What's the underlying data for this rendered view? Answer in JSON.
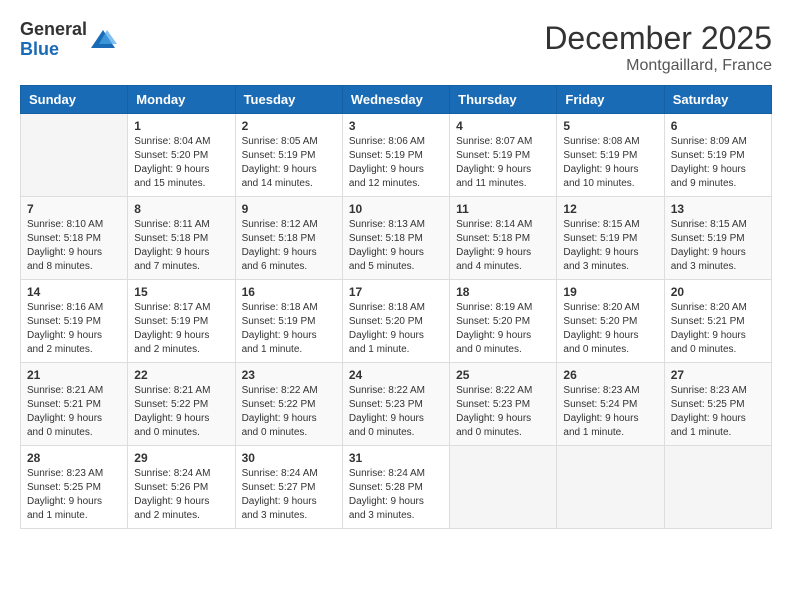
{
  "logo": {
    "general": "General",
    "blue": "Blue"
  },
  "title": {
    "month": "December 2025",
    "location": "Montgaillard, France"
  },
  "weekdays": [
    "Sunday",
    "Monday",
    "Tuesday",
    "Wednesday",
    "Thursday",
    "Friday",
    "Saturday"
  ],
  "weeks": [
    [
      {
        "day": "",
        "sunrise": "",
        "sunset": "",
        "daylight": ""
      },
      {
        "day": "1",
        "sunrise": "Sunrise: 8:04 AM",
        "sunset": "Sunset: 5:20 PM",
        "daylight": "Daylight: 9 hours and 15 minutes."
      },
      {
        "day": "2",
        "sunrise": "Sunrise: 8:05 AM",
        "sunset": "Sunset: 5:19 PM",
        "daylight": "Daylight: 9 hours and 14 minutes."
      },
      {
        "day": "3",
        "sunrise": "Sunrise: 8:06 AM",
        "sunset": "Sunset: 5:19 PM",
        "daylight": "Daylight: 9 hours and 12 minutes."
      },
      {
        "day": "4",
        "sunrise": "Sunrise: 8:07 AM",
        "sunset": "Sunset: 5:19 PM",
        "daylight": "Daylight: 9 hours and 11 minutes."
      },
      {
        "day": "5",
        "sunrise": "Sunrise: 8:08 AM",
        "sunset": "Sunset: 5:19 PM",
        "daylight": "Daylight: 9 hours and 10 minutes."
      },
      {
        "day": "6",
        "sunrise": "Sunrise: 8:09 AM",
        "sunset": "Sunset: 5:19 PM",
        "daylight": "Daylight: 9 hours and 9 minutes."
      }
    ],
    [
      {
        "day": "7",
        "sunrise": "Sunrise: 8:10 AM",
        "sunset": "Sunset: 5:18 PM",
        "daylight": "Daylight: 9 hours and 8 minutes."
      },
      {
        "day": "8",
        "sunrise": "Sunrise: 8:11 AM",
        "sunset": "Sunset: 5:18 PM",
        "daylight": "Daylight: 9 hours and 7 minutes."
      },
      {
        "day": "9",
        "sunrise": "Sunrise: 8:12 AM",
        "sunset": "Sunset: 5:18 PM",
        "daylight": "Daylight: 9 hours and 6 minutes."
      },
      {
        "day": "10",
        "sunrise": "Sunrise: 8:13 AM",
        "sunset": "Sunset: 5:18 PM",
        "daylight": "Daylight: 9 hours and 5 minutes."
      },
      {
        "day": "11",
        "sunrise": "Sunrise: 8:14 AM",
        "sunset": "Sunset: 5:18 PM",
        "daylight": "Daylight: 9 hours and 4 minutes."
      },
      {
        "day": "12",
        "sunrise": "Sunrise: 8:15 AM",
        "sunset": "Sunset: 5:19 PM",
        "daylight": "Daylight: 9 hours and 3 minutes."
      },
      {
        "day": "13",
        "sunrise": "Sunrise: 8:15 AM",
        "sunset": "Sunset: 5:19 PM",
        "daylight": "Daylight: 9 hours and 3 minutes."
      }
    ],
    [
      {
        "day": "14",
        "sunrise": "Sunrise: 8:16 AM",
        "sunset": "Sunset: 5:19 PM",
        "daylight": "Daylight: 9 hours and 2 minutes."
      },
      {
        "day": "15",
        "sunrise": "Sunrise: 8:17 AM",
        "sunset": "Sunset: 5:19 PM",
        "daylight": "Daylight: 9 hours and 2 minutes."
      },
      {
        "day": "16",
        "sunrise": "Sunrise: 8:18 AM",
        "sunset": "Sunset: 5:19 PM",
        "daylight": "Daylight: 9 hours and 1 minute."
      },
      {
        "day": "17",
        "sunrise": "Sunrise: 8:18 AM",
        "sunset": "Sunset: 5:20 PM",
        "daylight": "Daylight: 9 hours and 1 minute."
      },
      {
        "day": "18",
        "sunrise": "Sunrise: 8:19 AM",
        "sunset": "Sunset: 5:20 PM",
        "daylight": "Daylight: 9 hours and 0 minutes."
      },
      {
        "day": "19",
        "sunrise": "Sunrise: 8:20 AM",
        "sunset": "Sunset: 5:20 PM",
        "daylight": "Daylight: 9 hours and 0 minutes."
      },
      {
        "day": "20",
        "sunrise": "Sunrise: 8:20 AM",
        "sunset": "Sunset: 5:21 PM",
        "daylight": "Daylight: 9 hours and 0 minutes."
      }
    ],
    [
      {
        "day": "21",
        "sunrise": "Sunrise: 8:21 AM",
        "sunset": "Sunset: 5:21 PM",
        "daylight": "Daylight: 9 hours and 0 minutes."
      },
      {
        "day": "22",
        "sunrise": "Sunrise: 8:21 AM",
        "sunset": "Sunset: 5:22 PM",
        "daylight": "Daylight: 9 hours and 0 minutes."
      },
      {
        "day": "23",
        "sunrise": "Sunrise: 8:22 AM",
        "sunset": "Sunset: 5:22 PM",
        "daylight": "Daylight: 9 hours and 0 minutes."
      },
      {
        "day": "24",
        "sunrise": "Sunrise: 8:22 AM",
        "sunset": "Sunset: 5:23 PM",
        "daylight": "Daylight: 9 hours and 0 minutes."
      },
      {
        "day": "25",
        "sunrise": "Sunrise: 8:22 AM",
        "sunset": "Sunset: 5:23 PM",
        "daylight": "Daylight: 9 hours and 0 minutes."
      },
      {
        "day": "26",
        "sunrise": "Sunrise: 8:23 AM",
        "sunset": "Sunset: 5:24 PM",
        "daylight": "Daylight: 9 hours and 1 minute."
      },
      {
        "day": "27",
        "sunrise": "Sunrise: 8:23 AM",
        "sunset": "Sunset: 5:25 PM",
        "daylight": "Daylight: 9 hours and 1 minute."
      }
    ],
    [
      {
        "day": "28",
        "sunrise": "Sunrise: 8:23 AM",
        "sunset": "Sunset: 5:25 PM",
        "daylight": "Daylight: 9 hours and 1 minute."
      },
      {
        "day": "29",
        "sunrise": "Sunrise: 8:24 AM",
        "sunset": "Sunset: 5:26 PM",
        "daylight": "Daylight: 9 hours and 2 minutes."
      },
      {
        "day": "30",
        "sunrise": "Sunrise: 8:24 AM",
        "sunset": "Sunset: 5:27 PM",
        "daylight": "Daylight: 9 hours and 3 minutes."
      },
      {
        "day": "31",
        "sunrise": "Sunrise: 8:24 AM",
        "sunset": "Sunset: 5:28 PM",
        "daylight": "Daylight: 9 hours and 3 minutes."
      },
      {
        "day": "",
        "sunrise": "",
        "sunset": "",
        "daylight": ""
      },
      {
        "day": "",
        "sunrise": "",
        "sunset": "",
        "daylight": ""
      },
      {
        "day": "",
        "sunrise": "",
        "sunset": "",
        "daylight": ""
      }
    ]
  ]
}
